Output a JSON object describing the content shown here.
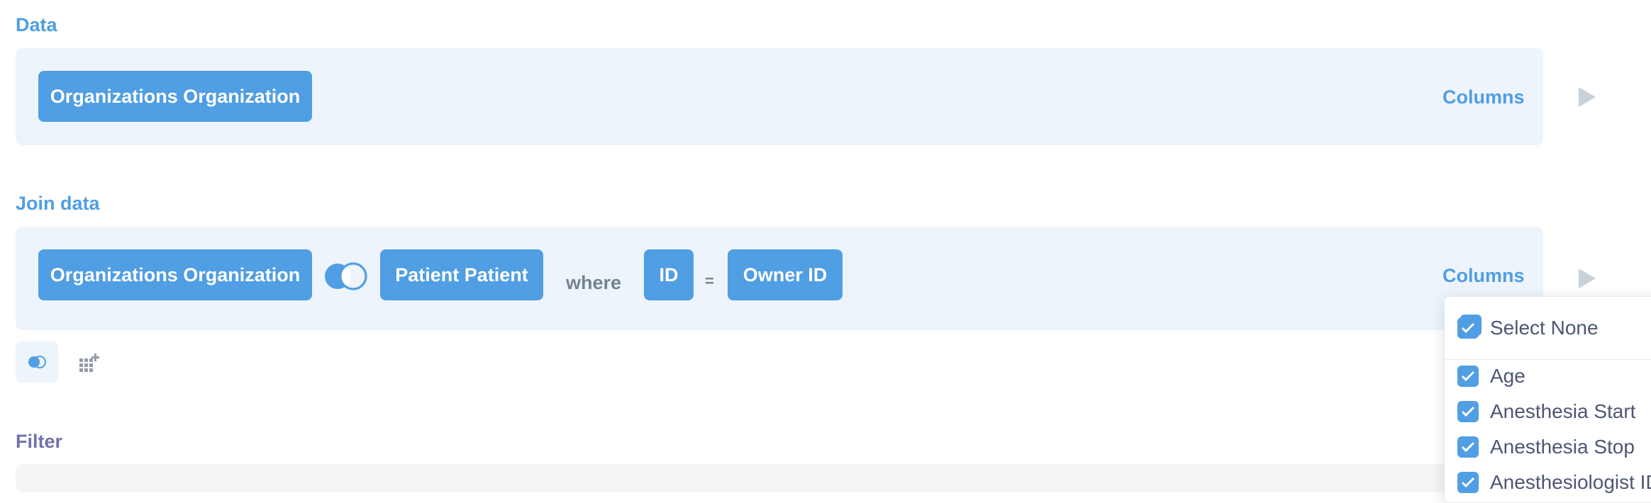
{
  "data_section": {
    "label": "Data",
    "table": "Organizations Organization",
    "columns_link": "Columns"
  },
  "join_section": {
    "label": "Join data",
    "left_table": "Organizations Organization",
    "right_table": "Patient Patient",
    "where": "where",
    "left_key": "ID",
    "operator": "=",
    "right_key": "Owner ID",
    "columns_link": "Columns"
  },
  "filter_section": {
    "label": "Filter"
  },
  "column_picker": {
    "select_none": "Select None",
    "items": [
      "Age",
      "Anesthesia Start",
      "Anesthesia Stop",
      "Anesthesiologist ID"
    ]
  },
  "colors": {
    "brand": "#509ee3",
    "filter": "#7172ad",
    "panel_bg": "#edf4fc"
  }
}
